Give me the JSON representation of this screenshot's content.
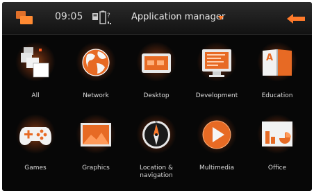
{
  "status_bar": {
    "time": "09:05",
    "title": "Application manager",
    "title_caret": "▾"
  },
  "colors": {
    "accent": "#ff7a2a",
    "background": "#070707",
    "text": "#dcdcdc"
  },
  "apps": [
    {
      "label": "All",
      "icon": "stacked-windows-icon"
    },
    {
      "label": "Network",
      "icon": "globe-icon"
    },
    {
      "label": "Desktop",
      "icon": "desktop-icon"
    },
    {
      "label": "Development",
      "icon": "monitor-code-icon"
    },
    {
      "label": "Education",
      "icon": "book-icon"
    },
    {
      "label": "Games",
      "icon": "gamepad-icon"
    },
    {
      "label": "Graphics",
      "icon": "picture-icon"
    },
    {
      "label": "Location &\nnavigation",
      "icon": "compass-icon"
    },
    {
      "label": "Multimedia",
      "icon": "play-icon"
    },
    {
      "label": "Office",
      "icon": "office-chart-icon"
    }
  ]
}
